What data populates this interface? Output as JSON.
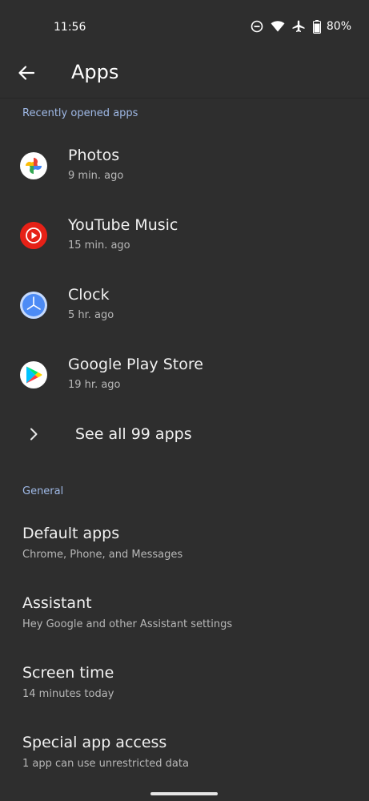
{
  "status_bar": {
    "time": "11:56",
    "battery": "80%",
    "icons": [
      "do-not-disturb-icon",
      "wifi-icon",
      "airplane-icon",
      "battery-icon"
    ]
  },
  "app_bar": {
    "back_icon": "back-arrow-icon",
    "title": "Apps"
  },
  "recent": {
    "header": "Recently opened apps",
    "apps": [
      {
        "name": "Photos",
        "time": "9 min. ago",
        "icon": "photos-icon"
      },
      {
        "name": "YouTube Music",
        "time": "15 min. ago",
        "icon": "youtube-music-icon"
      },
      {
        "name": "Clock",
        "time": "5 hr. ago",
        "icon": "clock-icon"
      },
      {
        "name": "Google Play Store",
        "time": "19 hr. ago",
        "icon": "play-store-icon"
      }
    ],
    "see_all": "See all 99 apps"
  },
  "general": {
    "header": "General",
    "items": [
      {
        "title": "Default apps",
        "subtitle": "Chrome, Phone, and Messages"
      },
      {
        "title": "Assistant",
        "subtitle": "Hey Google and other Assistant settings"
      },
      {
        "title": "Screen time",
        "subtitle": "14 minutes today"
      },
      {
        "title": "Special app access",
        "subtitle": "1 app can use unrestricted data"
      }
    ]
  },
  "colors": {
    "background": "#2e2e2e",
    "accent": "#9fb9e6",
    "primary_text": "#f1f1f1",
    "secondary_text": "#b8b8b8"
  }
}
